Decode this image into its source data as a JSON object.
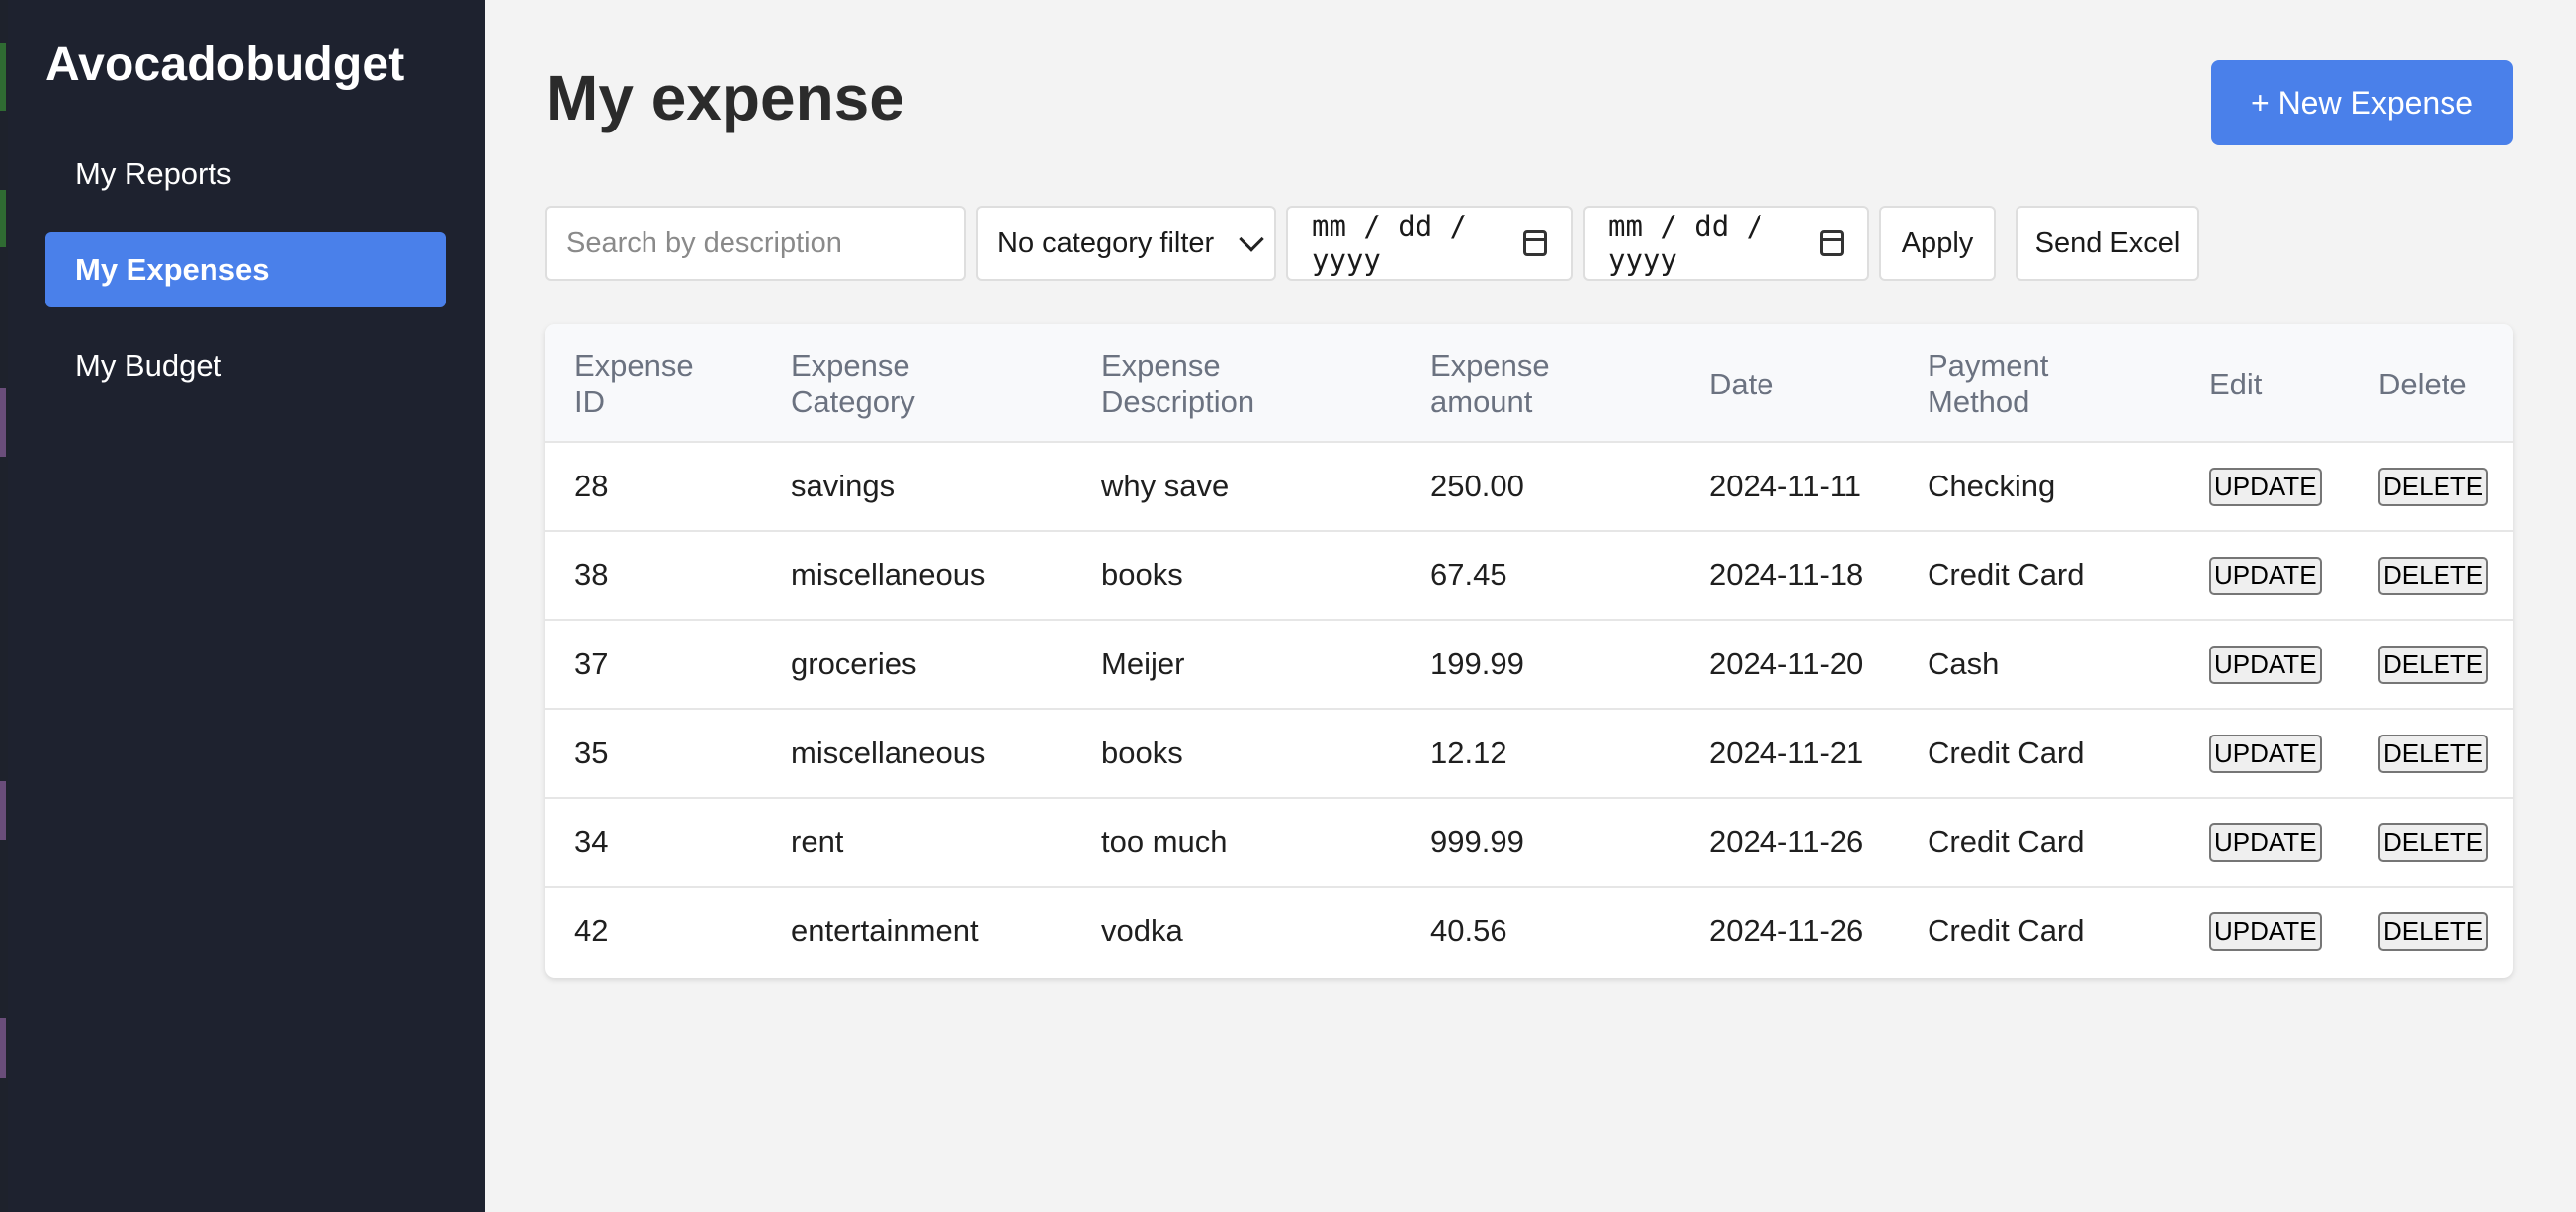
{
  "app": {
    "brand": "Avocadobudget"
  },
  "sidebar": {
    "items": [
      {
        "label": "My Reports"
      },
      {
        "label": "My Expenses"
      },
      {
        "label": "My Budget"
      }
    ],
    "active_index": 1
  },
  "header": {
    "title": "My expense",
    "new_button_label": "+ New Expense"
  },
  "filters": {
    "search_placeholder": "Search by description",
    "category_selected": "No category filter",
    "date_from": "mm / dd / yyyy",
    "date_to": "mm / dd / yyyy",
    "apply_label": "Apply",
    "send_excel_label": "Send Excel"
  },
  "table": {
    "headers": [
      [
        "Expense",
        "ID"
      ],
      [
        "Expense",
        "Category"
      ],
      [
        "Expense",
        "Description"
      ],
      [
        "Expense",
        "amount"
      ],
      [
        "Date"
      ],
      [
        "Payment",
        "Method"
      ],
      [
        "Edit"
      ],
      [
        "Delete"
      ]
    ],
    "update_label": "UPDATE",
    "delete_label": "DELETE",
    "rows": [
      {
        "id": "28",
        "category": "savings",
        "description": "why save",
        "amount": "250.00",
        "date": "2024-11-11",
        "method": "Checking"
      },
      {
        "id": "38",
        "category": "miscellaneous",
        "description": "books",
        "amount": "67.45",
        "date": "2024-11-18",
        "method": "Credit Card"
      },
      {
        "id": "37",
        "category": "groceries",
        "description": "Meijer",
        "amount": "199.99",
        "date": "2024-11-20",
        "method": "Cash"
      },
      {
        "id": "35",
        "category": "miscellaneous",
        "description": "books",
        "amount": "12.12",
        "date": "2024-11-21",
        "method": "Credit Card"
      },
      {
        "id": "34",
        "category": "rent",
        "description": "too much",
        "amount": "999.99",
        "date": "2024-11-26",
        "method": "Credit Card"
      },
      {
        "id": "42",
        "category": "entertainment",
        "description": "vodka",
        "amount": "40.56",
        "date": "2024-11-26",
        "method": "Credit Card"
      }
    ]
  },
  "colors": {
    "sidebar_bg": "#1e222f",
    "accent": "#4a80ea",
    "page_bg": "#f3f3f3"
  }
}
